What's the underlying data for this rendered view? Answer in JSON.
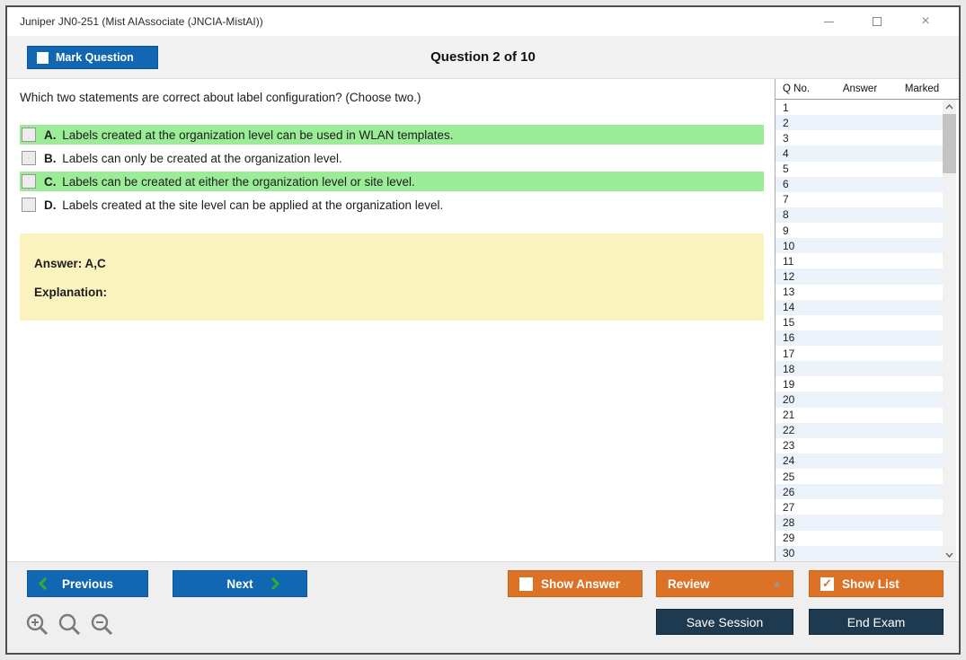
{
  "window": {
    "title": "Juniper JN0-251 (Mist AIAssociate (JNCIA-MistAI))",
    "close_glyph": "×"
  },
  "toolbar": {
    "mark_question_label": "Mark Question",
    "question_counter": "Question 2 of 10"
  },
  "question": {
    "text": "Which two statements are correct about label configuration? (Choose two.)",
    "options": [
      {
        "letter": "A.",
        "text": "Labels created at the organization level can be used in WLAN templates.",
        "highlighted": true,
        "checked": false
      },
      {
        "letter": "B.",
        "text": "Labels can only be created at the organization level.",
        "highlighted": false,
        "checked": false
      },
      {
        "letter": "C.",
        "text": "Labels can be created at either the organization level or site level.",
        "highlighted": true,
        "checked": false
      },
      {
        "letter": "D.",
        "text": "Labels created at the site level can be applied at the organization level.",
        "highlighted": false,
        "checked": false
      }
    ]
  },
  "answer_box": {
    "answer": "Answer: A,C",
    "explanation": "Explanation:"
  },
  "question_list": {
    "headers": {
      "q_no": "Q No.",
      "answer": "Answer",
      "marked": "Marked"
    },
    "rows": [
      {
        "q_no": "1",
        "answer": "",
        "marked": ""
      },
      {
        "q_no": "2",
        "answer": "",
        "marked": ""
      },
      {
        "q_no": "3",
        "answer": "",
        "marked": ""
      },
      {
        "q_no": "4",
        "answer": "",
        "marked": ""
      },
      {
        "q_no": "5",
        "answer": "",
        "marked": ""
      },
      {
        "q_no": "6",
        "answer": "",
        "marked": ""
      },
      {
        "q_no": "7",
        "answer": "",
        "marked": ""
      },
      {
        "q_no": "8",
        "answer": "",
        "marked": ""
      },
      {
        "q_no": "9",
        "answer": "",
        "marked": ""
      },
      {
        "q_no": "10",
        "answer": "",
        "marked": ""
      },
      {
        "q_no": "11",
        "answer": "",
        "marked": ""
      },
      {
        "q_no": "12",
        "answer": "",
        "marked": ""
      },
      {
        "q_no": "13",
        "answer": "",
        "marked": ""
      },
      {
        "q_no": "14",
        "answer": "",
        "marked": ""
      },
      {
        "q_no": "15",
        "answer": "",
        "marked": ""
      },
      {
        "q_no": "16",
        "answer": "",
        "marked": ""
      },
      {
        "q_no": "17",
        "answer": "",
        "marked": ""
      },
      {
        "q_no": "18",
        "answer": "",
        "marked": ""
      },
      {
        "q_no": "19",
        "answer": "",
        "marked": ""
      },
      {
        "q_no": "20",
        "answer": "",
        "marked": ""
      },
      {
        "q_no": "21",
        "answer": "",
        "marked": ""
      },
      {
        "q_no": "22",
        "answer": "",
        "marked": ""
      },
      {
        "q_no": "23",
        "answer": "",
        "marked": ""
      },
      {
        "q_no": "24",
        "answer": "",
        "marked": ""
      },
      {
        "q_no": "25",
        "answer": "",
        "marked": ""
      },
      {
        "q_no": "26",
        "answer": "",
        "marked": ""
      },
      {
        "q_no": "27",
        "answer": "",
        "marked": ""
      },
      {
        "q_no": "28",
        "answer": "",
        "marked": ""
      },
      {
        "q_no": "29",
        "answer": "",
        "marked": ""
      },
      {
        "q_no": "30",
        "answer": "",
        "marked": ""
      }
    ]
  },
  "footer": {
    "previous_label": "Previous",
    "next_label": "Next",
    "show_answer_label": "Show Answer",
    "review_label": "Review",
    "show_list_label": "Show List",
    "save_session_label": "Save Session",
    "end_exam_label": "End Exam",
    "show_answer_checked": false,
    "show_list_checked": true
  },
  "icons": {
    "review_triangle": "▲",
    "show_list_check": "✓",
    "zoom_icons": [
      "zoom-in-magnifier",
      "magnifier",
      "zoom-out-magnifier"
    ]
  },
  "colors": {
    "blue": "#1267b2",
    "orange": "#dc7226",
    "navy": "#1e3a50",
    "green_highlight": "#9bec97",
    "yellow_answer_box": "#fbf3be",
    "green_chevron": "#2fae2f",
    "alt_row": "#ebf2f9"
  }
}
